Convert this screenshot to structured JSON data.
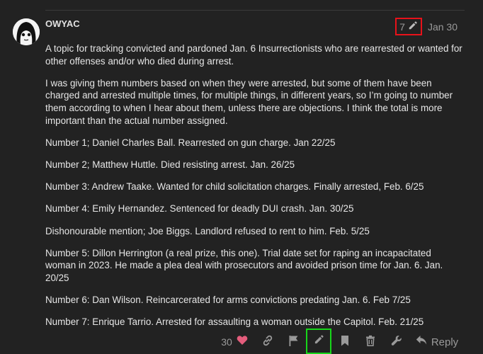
{
  "post": {
    "username": "OWYAC",
    "edit_count": "7",
    "date": "Jan 30",
    "paragraphs": [
      "A topic for tracking convicted and pardoned Jan. 6 Insurrectionists who are rearrested or wanted for other offenses and/or who died during arrest.",
      "I was giving them numbers based on when they were arrested, but some of them have been charged and arrested multiple times, for multiple things, in different years, so I’m going to number them according to when I hear about them, unless there are objections. I think the total is more important than the actual number assigned.",
      "Number 1; Daniel Charles Ball. Rearrested on gun charge. Jan 22/25",
      "Number 2; Matthew Huttle. Died resisting arrest. Jan. 26/25",
      "Number 3: Andrew Taake. Wanted for child solicitation charges. Finally arrested, Feb. 6/25",
      "Number 4: Emily Hernandez. Sentenced for deadly DUI crash. Jan. 30/25",
      "Dishonourable mention; Joe Biggs. Landlord refused to rent to him. Feb. 5/25",
      "Number 5: Dillon Herrington (a real prize, this one). Trial date set for raping an incapacitated woman in 2023. He made a plea deal with prosecutors and avoided prison time for Jan. 6. Jan. 20/25",
      "Number 6: Dan Wilson. Reincarcerated for arms convictions predating Jan. 6. Feb 7/25",
      "Number 7: Enrique Tarrio. Arrested for assaulting a woman outside the Capitol. Feb. 21/25"
    ]
  },
  "actions": {
    "like_count": "30",
    "reply_label": "Reply"
  },
  "colors": {
    "background": "#222222",
    "heart": "#e45d7c",
    "highlight_edit_history": "#e8121a",
    "highlight_edit_button": "#17d61a"
  },
  "icons": [
    "avatar",
    "pencil-icon",
    "heart-icon",
    "link-icon",
    "flag-icon",
    "pencil-icon",
    "bookmark-icon",
    "trash-icon",
    "wrench-icon",
    "reply-icon"
  ]
}
